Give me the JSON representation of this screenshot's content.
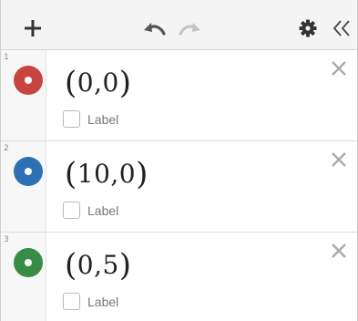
{
  "toolbar": {
    "add_icon": "plus-icon",
    "undo_icon": "undo-icon",
    "redo_icon": "redo-icon",
    "settings_icon": "gear-icon",
    "collapse_icon": "double-chevron-left-icon"
  },
  "expressions": [
    {
      "index": "1",
      "expression": "(0,0)",
      "inner": "0,0",
      "color": "#c74440",
      "label_checkbox_text": "Label",
      "label_checked": false
    },
    {
      "index": "2",
      "expression": "(10,0)",
      "inner": "10,0",
      "color": "#2d70b3",
      "label_checkbox_text": "Label",
      "label_checked": false
    },
    {
      "index": "3",
      "expression": "(0,5)",
      "inner": "0,5",
      "color": "#388c46",
      "label_checkbox_text": "Label",
      "label_checked": false
    }
  ]
}
